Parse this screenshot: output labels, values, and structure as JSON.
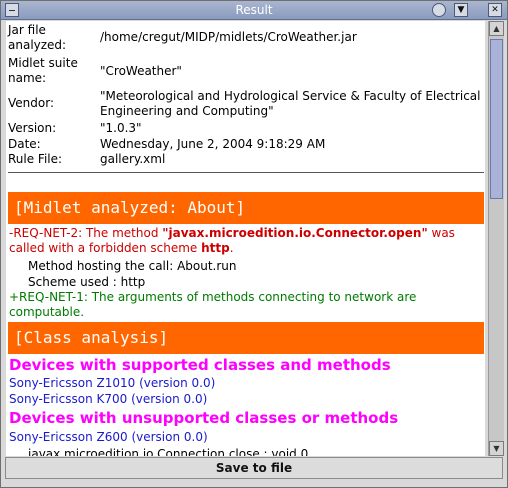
{
  "window": {
    "title": "Result"
  },
  "meta": {
    "rows": [
      {
        "label": "Jar file analyzed:",
        "value": "/home/cregut/MIDP/midlets/CroWeather.jar"
      },
      {
        "label": "Midlet suite name:",
        "value": "\"CroWeather\""
      },
      {
        "label": "Vendor:",
        "value": "\"Meteorological and Hydrological Service & Faculty of Electrical Engineering and Computing\""
      },
      {
        "label": "Version:",
        "value": "\"1.0.3\""
      },
      {
        "label": "Date:",
        "value": "Wednesday, June 2, 2004 9:18:29 AM"
      },
      {
        "label": "Rule File:",
        "value": "gallery.xml"
      }
    ]
  },
  "sections": {
    "midlet_header": "[Midlet analyzed: About]",
    "req_net2_prefix": "-REQ-NET-2: The method ",
    "req_net2_method": "\"javax.microedition.io.Connector.open\"",
    "req_net2_mid": " was called with a forbidden scheme ",
    "req_net2_scheme": "http",
    "req_net2_end": ".",
    "method_hosting": "Method hosting the call: About.run",
    "scheme_used": "Scheme used : http",
    "req_net1": "+REQ-NET-1: The arguments of methods connecting to network are computable.",
    "class_header": "[Class analysis]",
    "supported_head": "Devices with supported classes and methods",
    "supported_devices": [
      "Sony-Ericsson Z1010 (version 0.0)",
      "Sony-Ericsson K700 (version 0.0)"
    ],
    "unsupported_head": "Devices with unsupported classes or methods",
    "unsupported_devices": [
      "Sony-Ericsson Z600 (version 0.0)"
    ],
    "partial_line": "javax.microedition.io.Connection.close : void 0"
  },
  "footer": {
    "save_label": "Save to file"
  },
  "colors": {
    "section_bg": "#ff6600",
    "red_text": "#cc0000",
    "green_text": "#007a00",
    "magenta_head": "#ff00ff",
    "device_blue": "#1a1acc"
  }
}
